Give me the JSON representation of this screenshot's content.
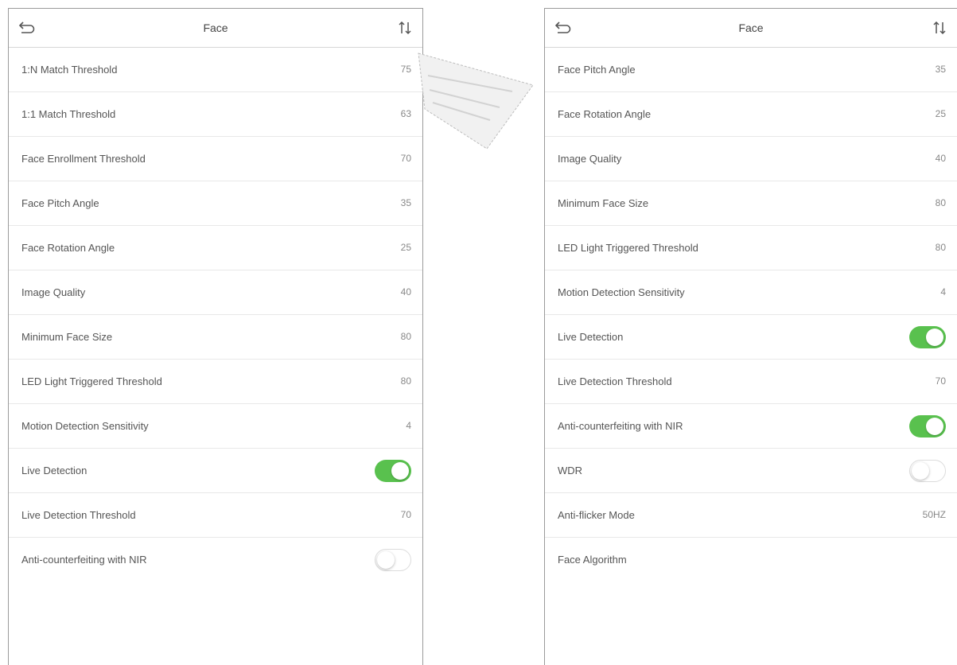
{
  "left_panel": {
    "title": "Face",
    "rows": [
      {
        "label": "1:N Match Threshold",
        "value": "75"
      },
      {
        "label": "1:1 Match Threshold",
        "value": "63"
      },
      {
        "label": "Face Enrollment Threshold",
        "value": "70"
      },
      {
        "label": "Face Pitch Angle",
        "value": "35"
      },
      {
        "label": "Face Rotation Angle",
        "value": "25"
      },
      {
        "label": "Image Quality",
        "value": "40"
      },
      {
        "label": "Minimum Face Size",
        "value": "80"
      },
      {
        "label": "LED Light Triggered Threshold",
        "value": "80"
      },
      {
        "label": "Motion Detection Sensitivity",
        "value": "4"
      },
      {
        "label": "Live Detection",
        "toggle": "on"
      },
      {
        "label": "Live Detection Threshold",
        "value": "70"
      },
      {
        "label": "Anti-counterfeiting with NIR",
        "toggle": "off"
      }
    ]
  },
  "right_panel": {
    "title": "Face",
    "rows": [
      {
        "label": "Face Pitch Angle",
        "value": "35"
      },
      {
        "label": "Face Rotation Angle",
        "value": "25"
      },
      {
        "label": "Image Quality",
        "value": "40"
      },
      {
        "label": "Minimum Face Size",
        "value": "80"
      },
      {
        "label": "LED Light Triggered Threshold",
        "value": "80"
      },
      {
        "label": "Motion Detection Sensitivity",
        "value": "4"
      },
      {
        "label": "Live Detection",
        "toggle": "on"
      },
      {
        "label": "Live Detection Threshold",
        "value": "70"
      },
      {
        "label": "Anti-counterfeiting with NIR",
        "toggle": "on"
      },
      {
        "label": "WDR",
        "toggle": "off"
      },
      {
        "label": "Anti-flicker Mode",
        "value": "50HZ"
      },
      {
        "label": "Face Algorithm"
      }
    ]
  },
  "icons": {
    "back": "back-arrow-icon",
    "sort": "sort-arrows-icon"
  },
  "colors": {
    "toggle_on": "#59c14e",
    "divider": "#e8e8e8",
    "panel_border": "#9a9a9a"
  }
}
